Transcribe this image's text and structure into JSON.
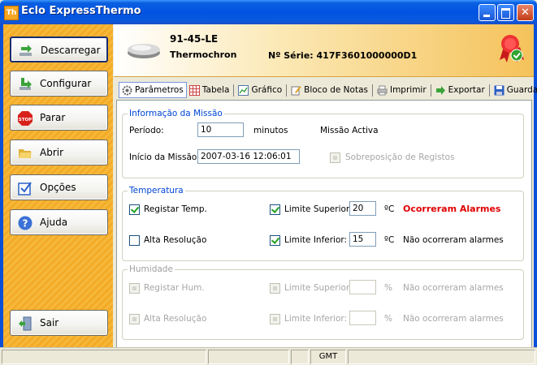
{
  "window": {
    "title": "Eclo ExpressThermo",
    "logo_text": "Th"
  },
  "sidebar": {
    "items": [
      {
        "label": "Descarregar",
        "icon": "download-arrow-icon"
      },
      {
        "label": "Configurar",
        "icon": "configure-arrow-icon"
      },
      {
        "label": "Parar",
        "icon": "stop-sign-icon",
        "icon_text": "STOP"
      },
      {
        "label": "Abrir",
        "icon": "folder-open-icon"
      },
      {
        "label": "Opções",
        "icon": "checkbox-options-icon"
      },
      {
        "label": "Ajuda",
        "icon": "help-icon",
        "icon_text": "?"
      },
      {
        "label": "Sair",
        "icon": "exit-door-icon"
      }
    ]
  },
  "device": {
    "name": "91-45-LE",
    "model": "Thermochron",
    "serial_label": "Nº Série:",
    "serial": "417F3601000000D1"
  },
  "toolbar": {
    "items": [
      {
        "label": "Parâmetros",
        "active": true
      },
      {
        "label": "Tabela"
      },
      {
        "label": "Gráfico"
      },
      {
        "label": "Bloco de Notas"
      },
      {
        "label": "Imprimir"
      },
      {
        "label": "Exportar"
      },
      {
        "label": "Guardar"
      }
    ]
  },
  "mission": {
    "title": "Informação da Missão",
    "period_label": "Período:",
    "period_value": "10",
    "period_unit": "minutos",
    "status": "Missão Activa",
    "start_label": "Início da Missão:",
    "start_value": "2007-03-16 12:06:01",
    "overwrite_label": "Sobreposição de Registos"
  },
  "temperature": {
    "title": "Temperatura",
    "register_label": "Registar Temp.",
    "highres_label": "Alta Resolução",
    "upper_label": "Limite Superior:",
    "upper_value": "20",
    "upper_unit": "ºC",
    "upper_status": "Ocorreram Alarmes",
    "lower_label": "Limite Inferior:",
    "lower_value": "15",
    "lower_unit": "ºC",
    "lower_status": "Não ocorreram alarmes"
  },
  "humidity": {
    "title": "Humidade",
    "register_label": "Registar Hum.",
    "highres_label": "Alta Resolução",
    "upper_label": "Limite Superior:",
    "upper_unit": "%",
    "upper_status": "Não ocorreram alarmes",
    "lower_label": "Limite Inferior:",
    "lower_unit": "%",
    "lower_status": "Não ocorreram alarmes"
  },
  "statusbar": {
    "timezone": "GMT"
  },
  "colors": {
    "accent": "#0054e3",
    "sidebar": "#f6b83a",
    "alarm": "#e00000"
  }
}
